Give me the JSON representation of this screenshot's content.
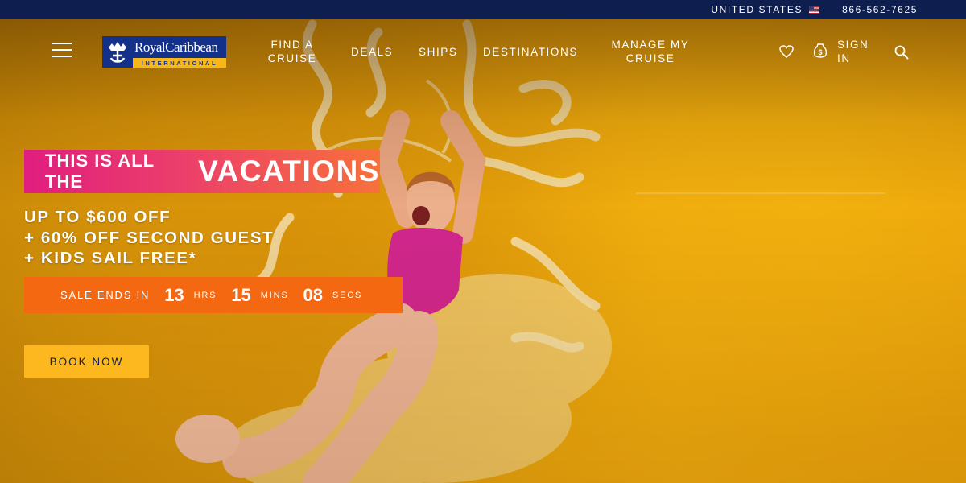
{
  "topbar": {
    "country": "UNITED STATES",
    "flag_icon": "us-flag-icon",
    "phone": "866-562-7625"
  },
  "nav": {
    "logo": {
      "brand": "RoyalCaribbean",
      "sub": "INTERNATIONAL",
      "brand_color": "#14318a",
      "accent_color": "#f7b718"
    },
    "links": {
      "find_cruise": [
        "FIND A",
        "CRUISE"
      ],
      "deals": "DEALS",
      "ships": "SHIPS",
      "destinations": "DESTINATIONS",
      "manage": [
        "MANAGE MY",
        "CRUISE"
      ],
      "sign_in": [
        "SIGN",
        "IN"
      ]
    },
    "icons": [
      "menu-icon",
      "heart-icon",
      "dollar-tag-icon",
      "search-icon"
    ]
  },
  "hero": {
    "badge_small": "THIS IS ALL THE",
    "badge_big": "VACATIONS",
    "offer_lines": [
      "UP TO $600 OFF",
      "+ 60% OFF SECOND GUEST",
      "+ KIDS SAIL FREE*"
    ],
    "countdown": {
      "label": "SALE ENDS IN",
      "hours": "13",
      "hours_unit": "HRS",
      "mins": "15",
      "mins_unit": "MINS",
      "secs": "08",
      "secs_unit": "SECS"
    },
    "cta": "BOOK NOW"
  },
  "colors": {
    "topbar_bg": "#0e1e4f",
    "countdown_bg": "#f46811",
    "cta_bg": "#fdb820",
    "badge_gradient": [
      "#e01e7f",
      "#f7713a"
    ]
  }
}
